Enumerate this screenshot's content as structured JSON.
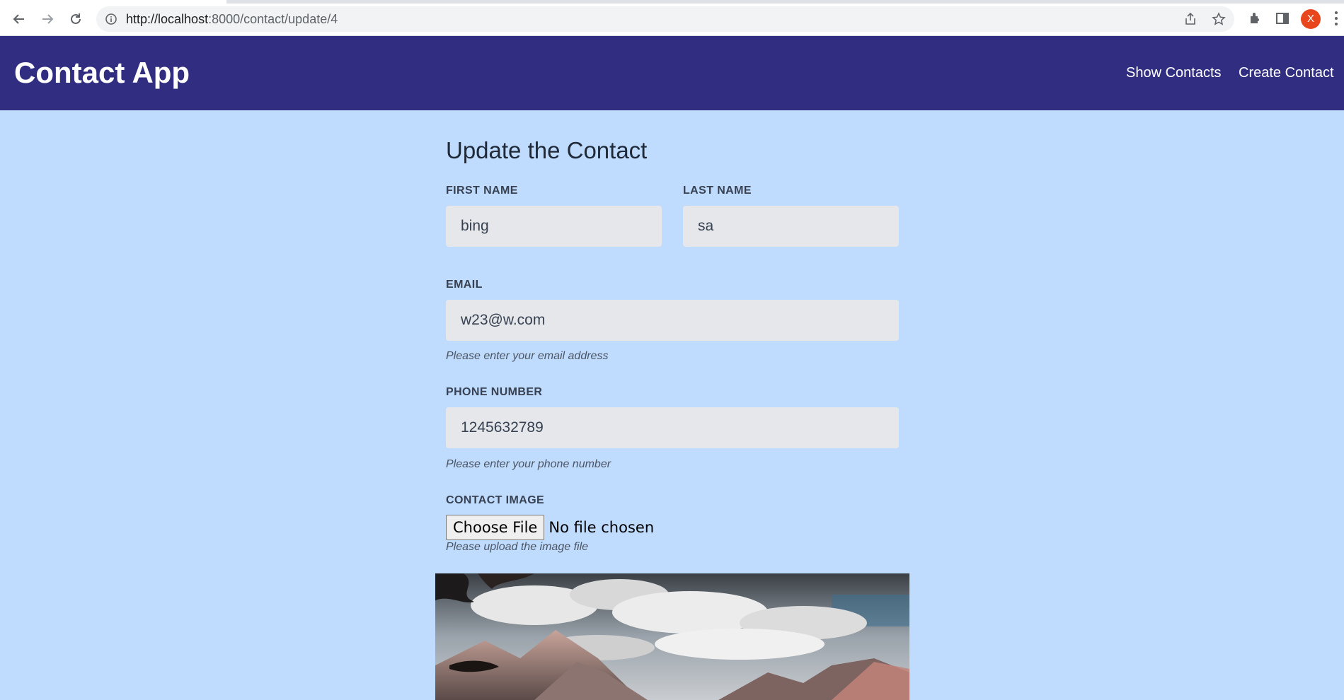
{
  "browser": {
    "url_host": "http://localhost",
    "url_path": ":8000/contact/update/4",
    "avatar_letter": "X",
    "icons": [
      "back-arrow-icon",
      "forward-arrow-icon",
      "reload-icon",
      "info-icon",
      "share-icon",
      "star-icon",
      "extensions-icon",
      "sidepanel-icon",
      "kebab-menu-icon"
    ]
  },
  "header": {
    "title": "Contact App",
    "nav": [
      "Show Contacts",
      "Create Contact"
    ],
    "bg_color": "#312e81"
  },
  "form": {
    "title": "Update the Contact",
    "first_name": {
      "label": "FIRST NAME",
      "value": "bing"
    },
    "last_name": {
      "label": "LAST NAME",
      "value": "sa"
    },
    "email": {
      "label": "EMAIL",
      "value": "w23@w.com",
      "help": "Please enter your email address"
    },
    "phone": {
      "label": "PHONE NUMBER",
      "value": "1245632789",
      "help": "Please enter your phone number"
    },
    "image": {
      "label": "CONTACT IMAGE",
      "button": "Choose File",
      "status": "No file chosen",
      "help": "Please upload the image file"
    }
  },
  "colors": {
    "page_bg": "#bfdbfe",
    "input_bg": "#e5e7eb"
  }
}
